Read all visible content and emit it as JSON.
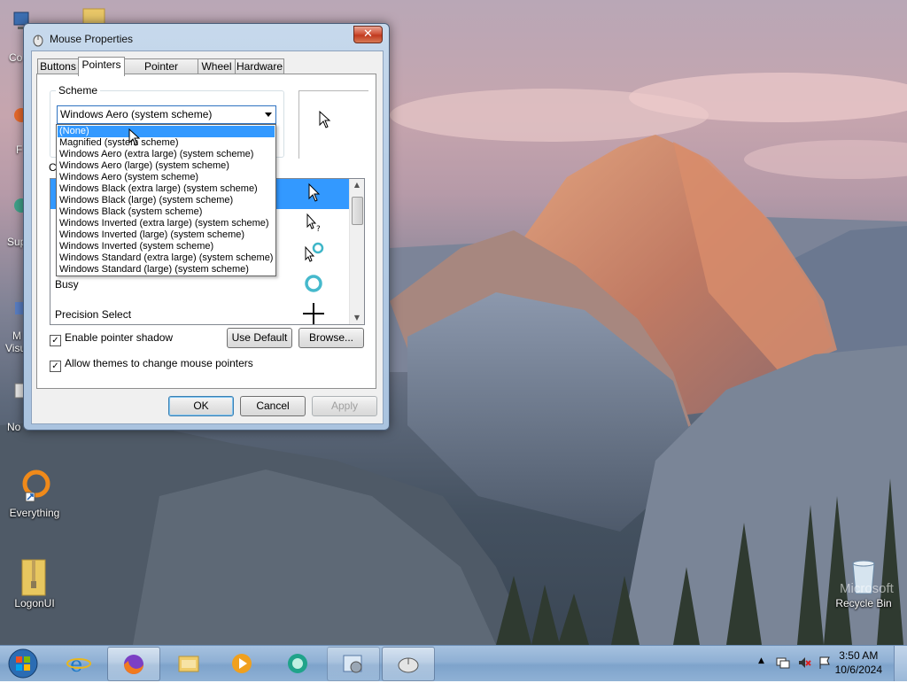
{
  "desktop": {
    "icons": [
      {
        "label": "Everything"
      },
      {
        "label": "LogonUI"
      },
      {
        "label": "Recycle Bin"
      }
    ],
    "partial_labels": [
      "Co",
      "F",
      "Sup",
      "M",
      "Visu",
      "No"
    ],
    "watermark": "Microsoft"
  },
  "window": {
    "title": "Mouse Properties",
    "close_label": "✕",
    "tabs": [
      {
        "label": "Buttons"
      },
      {
        "label": "Pointers"
      },
      {
        "label": "Pointer Options"
      },
      {
        "label": "Wheel"
      },
      {
        "label": "Hardware"
      }
    ],
    "scheme": {
      "legend": "Scheme",
      "selected": "Windows Aero (system scheme)"
    },
    "customize_label": "Cu",
    "cursor_rows": [
      {
        "label": "",
        "icon": "arrow-icon"
      },
      {
        "label": "",
        "icon": "help-select-icon"
      },
      {
        "label": "",
        "icon": "working-in-background-icon"
      },
      {
        "label": "Busy",
        "icon": "busy-ring-icon"
      },
      {
        "label": "Precision Select",
        "icon": "crosshair-icon"
      }
    ],
    "enable_shadow": {
      "label": "Enable pointer shadow",
      "checked": true
    },
    "allow_themes": {
      "label": "Allow themes to change mouse pointers",
      "checked": true
    },
    "use_default": "Use Default",
    "browse": "Browse...",
    "ok": "OK",
    "cancel": "Cancel",
    "apply": "Apply"
  },
  "dropdown": {
    "items": [
      "(None)",
      "Magnified (system scheme)",
      "Windows Aero (extra large) (system scheme)",
      "Windows Aero (large) (system scheme)",
      "Windows Aero (system scheme)",
      "Windows Black (extra large) (system scheme)",
      "Windows Black (large) (system scheme)",
      "Windows Black (system scheme)",
      "Windows Inverted (extra large) (system scheme)",
      "Windows Inverted (large) (system scheme)",
      "Windows Inverted (system scheme)",
      "Windows Standard (extra large) (system scheme)",
      "Windows Standard (large) (system scheme)"
    ],
    "highlighted_index": 0
  },
  "taskbar": {
    "pinned": [
      "start-orb",
      "internet-explorer",
      "firefox",
      "file-explorer",
      "media-player",
      "browser",
      "control-panel",
      "mouse-properties"
    ],
    "time": "3:50 AM",
    "date": "10/6/2024"
  },
  "colors": {
    "selection": "#3399ff",
    "taskbar": "#8fb0d4"
  }
}
